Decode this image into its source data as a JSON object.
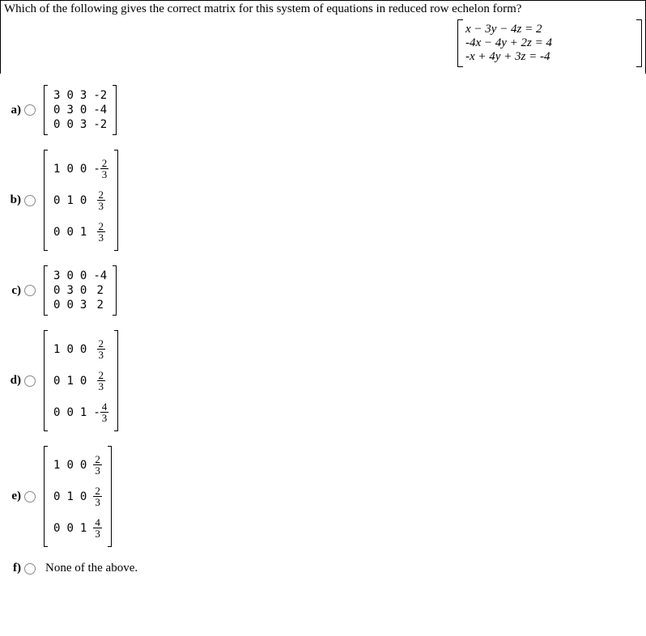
{
  "question": "Which of the following gives the correct matrix for this system of equations in reduced row echelon form?",
  "system": {
    "row1": "x − 3y − 4z = 2",
    "row2": "-4x − 4y + 2z = 4",
    "row3": "-x + 4y + 3z = -4"
  },
  "options": {
    "a": {
      "label": "a)",
      "rows": [
        [
          "3",
          "0",
          "3",
          "-2"
        ],
        [
          "0",
          "3",
          "0",
          "-4"
        ],
        [
          "0",
          "0",
          "3",
          "-2"
        ]
      ]
    },
    "b": {
      "label": "b)",
      "rows": [
        [
          "1",
          "0",
          "0",
          {
            "neg": true,
            "num": "2",
            "den": "3"
          }
        ],
        [
          "0",
          "1",
          "0",
          {
            "num": "2",
            "den": "3"
          }
        ],
        [
          "0",
          "0",
          "1",
          {
            "num": "2",
            "den": "3"
          }
        ]
      ]
    },
    "c": {
      "label": "c)",
      "rows": [
        [
          "3",
          "0",
          "0",
          "-4"
        ],
        [
          "0",
          "3",
          "0",
          "2"
        ],
        [
          "0",
          "0",
          "3",
          "2"
        ]
      ]
    },
    "d": {
      "label": "d)",
      "rows": [
        [
          "1",
          "0",
          "0",
          {
            "num": "2",
            "den": "3"
          }
        ],
        [
          "0",
          "1",
          "0",
          {
            "num": "2",
            "den": "3"
          }
        ],
        [
          "0",
          "0",
          "1",
          {
            "neg": true,
            "num": "4",
            "den": "3"
          }
        ]
      ]
    },
    "e": {
      "label": "e)",
      "rows": [
        [
          "1",
          "0",
          "0",
          {
            "num": "2",
            "den": "3"
          }
        ],
        [
          "0",
          "1",
          "0",
          {
            "num": "2",
            "den": "3"
          }
        ],
        [
          "0",
          "0",
          "1",
          {
            "num": "4",
            "den": "3"
          }
        ]
      ]
    },
    "f": {
      "label": "f)",
      "text": "None of the above."
    }
  }
}
